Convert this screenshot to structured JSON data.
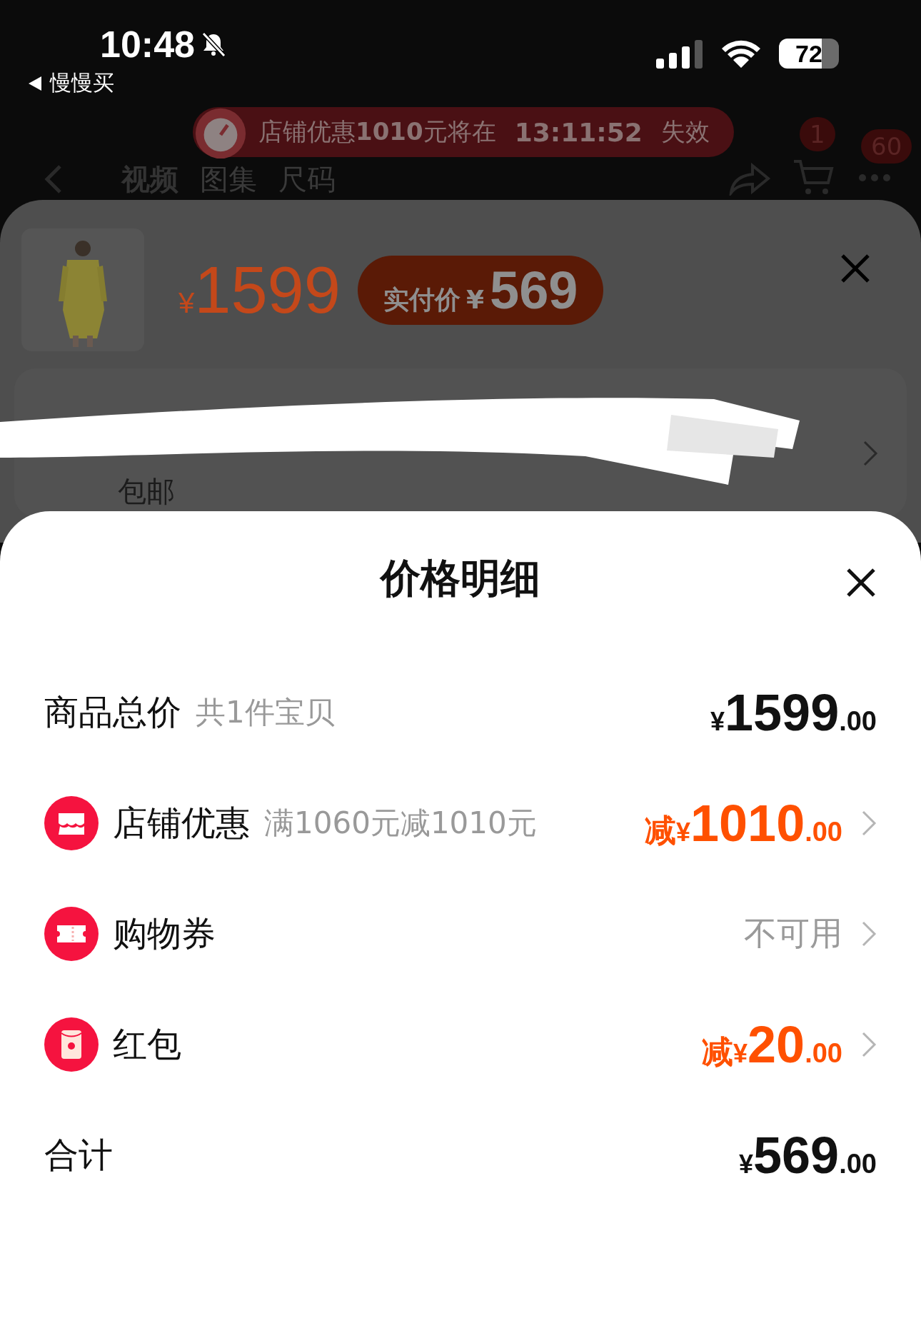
{
  "status_bar": {
    "time": "10:48",
    "back_label": "慢慢买",
    "battery": "72"
  },
  "banner": {
    "text": "店铺优惠**1010**元将在",
    "countdown": "13:11:52",
    "suffix": "失效"
  },
  "nav": {
    "tabs": [
      {
        "label": "视频",
        "selected": true
      },
      {
        "label": "图集",
        "selected": false
      },
      {
        "label": "尺码",
        "selected": false
      }
    ],
    "cart_badge": "1",
    "more_badge": "60"
  },
  "product_sheet": {
    "currency": "¥",
    "price": "1599",
    "paid_label": "实付价",
    "paid_currency": "¥",
    "paid_price": "569",
    "shipping_note": "包邮"
  },
  "price_detail": {
    "title": "价格明细",
    "rows": [
      {
        "kind": "plain",
        "label": "商品总价",
        "note": "共1件宝贝",
        "prefix": "",
        "currency": "¥",
        "integer": "1599",
        "decimals": ".00",
        "highlight": false,
        "chevron": false
      },
      {
        "kind": "shop",
        "label": "店铺优惠",
        "note": "满1060元减1010元",
        "prefix": "减",
        "currency": "¥",
        "integer": "1010",
        "decimals": ".00",
        "highlight": true,
        "chevron": true
      },
      {
        "kind": "coupon",
        "label": "购物券",
        "status": "不可用",
        "chevron": true
      },
      {
        "kind": "redpacket",
        "label": "红包",
        "prefix": "减",
        "currency": "¥",
        "integer": "20",
        "decimals": ".00",
        "highlight": true,
        "chevron": true
      },
      {
        "kind": "plain",
        "label": "合计",
        "prefix": "",
        "currency": "¥",
        "integer": "569",
        "decimals": ".00",
        "highlight": false,
        "chevron": false
      }
    ]
  }
}
